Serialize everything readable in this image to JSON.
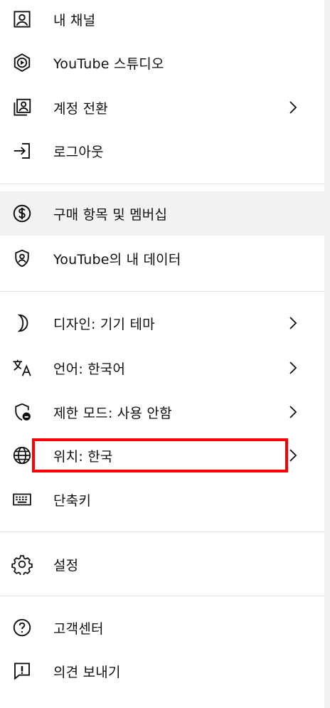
{
  "menu": {
    "items": [
      {
        "label": "내 채널",
        "icon": "person-box-icon"
      },
      {
        "label": "YouTube 스튜디오",
        "icon": "studio-hexagon-icon"
      },
      {
        "label": "계정 전환",
        "icon": "switch-account-icon"
      },
      {
        "label": "로그아웃",
        "icon": "sign-out-icon"
      },
      {
        "label": "구매 항목 및 멤버십",
        "icon": "dollar-circle-icon"
      },
      {
        "label": "YouTube의 내 데이터",
        "icon": "shield-person-icon"
      },
      {
        "label": "디자인: 기기 테마",
        "icon": "crescent-moon-icon"
      },
      {
        "label": "언어: 한국어",
        "icon": "translate-icon"
      },
      {
        "label": "제한 모드: 사용 안함",
        "icon": "restricted-shield-icon"
      },
      {
        "label": "위치: 한국",
        "icon": "globe-icon"
      },
      {
        "label": "단축키",
        "icon": "keyboard-icon"
      },
      {
        "label": "설정",
        "icon": "gear-icon"
      },
      {
        "label": "고객센터",
        "icon": "help-circle-icon"
      },
      {
        "label": "의견 보내기",
        "icon": "feedback-icon"
      }
    ]
  },
  "colors": {
    "highlight_box": "#ff0000",
    "active_row": "#f2f2f2",
    "text": "#0f0f0f",
    "divider": "#e5e5e5"
  }
}
